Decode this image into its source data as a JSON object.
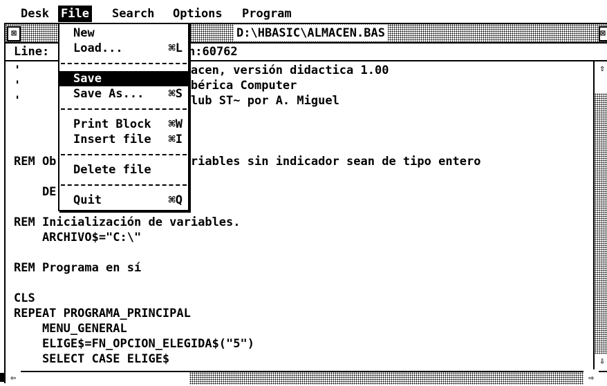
{
  "menubar": {
    "items": [
      "Desk",
      "File",
      "Search",
      "Options",
      "Program"
    ],
    "active": "File"
  },
  "window": {
    "title": "D:\\HBASIC\\ALMACEN.BAS",
    "close_glyph": "⊠",
    "full_glyph": "⊠",
    "info_label": "Line:",
    "info_value": "n:60762"
  },
  "file_menu": {
    "items": [
      {
        "label": "New",
        "shortcut": ""
      },
      {
        "label": "Load...",
        "shortcut": "⌘L"
      },
      {
        "label": "Save",
        "shortcut": ""
      },
      {
        "label": "Save As...",
        "shortcut": "⌘S"
      },
      {
        "label": "Print Block",
        "shortcut": "⌘W"
      },
      {
        "label": "Insert file",
        "shortcut": "⌘I"
      },
      {
        "label": "Delete file",
        "shortcut": ""
      },
      {
        "label": "Quit",
        "shortcut": "⌘Q"
      }
    ],
    "selected": "Save"
  },
  "editor": {
    "lines": [
      "'                  de almacen, versión didactica 1.00",
      "'                  1988 Ibérica Computer",
      "'                  ara ~Club ST~ por A. Miguel",
      "",
      "",
      "",
      "REM Ob             las variables sin indicador sean de tipo entero",
      "",
      "    DE",
      "",
      "REM Inicialización de variables.",
      "    ARCHIVO$=\"C:\\\"",
      "",
      "REM Programa en sí",
      "",
      "CLS",
      "REPEAT PROGRAMA_PRINCIPAL",
      "    MENU_GENERAL",
      "    ELIGE$=FN_OPCION_ELEGIDA$(\"5\")",
      "    SELECT CASE ELIGE$"
    ]
  },
  "scroll": {
    "up": "⇧",
    "down": "⇩",
    "left": "⇦",
    "right": "⇨"
  },
  "colors": {
    "fg": "#000000",
    "bg": "#ffffff"
  }
}
